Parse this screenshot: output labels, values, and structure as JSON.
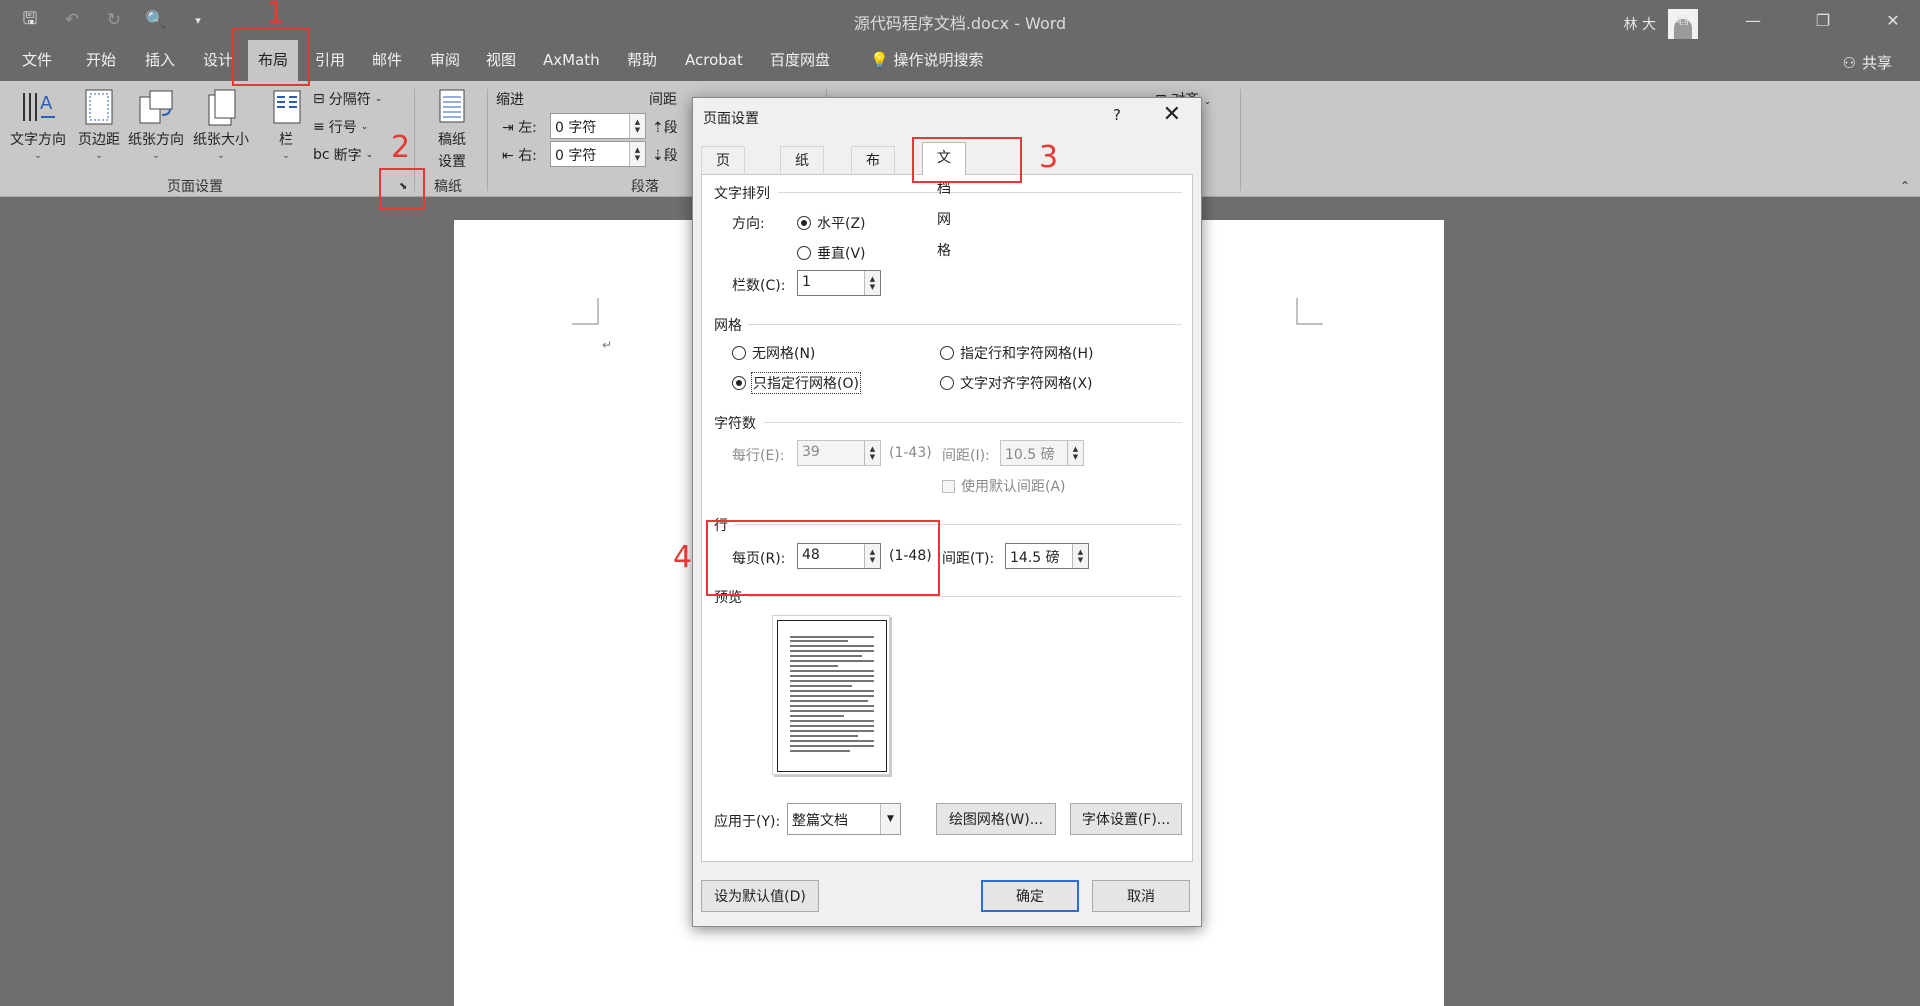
{
  "titlebar": {
    "doc_title": "源代码程序文档.docx - Word",
    "user_name": "林 大",
    "qat_icons": [
      "save-icon",
      "undo-icon",
      "redo-icon",
      "print-preview-icon",
      "customize-icon"
    ],
    "qat_glyphs": [
      "🖫",
      "↶",
      "↻",
      "🔍",
      "▾"
    ],
    "win_glyphs": [
      "⧉",
      "—",
      "❐",
      "✕"
    ]
  },
  "tabs": [
    "文件",
    "开始",
    "插入",
    "设计",
    "布局",
    "引用",
    "邮件",
    "审阅",
    "视图",
    "AxMath",
    "帮助",
    "Acrobat",
    "百度网盘",
    "操作说明搜索"
  ],
  "active_tab": "布局",
  "share_label": "共享",
  "ribbon": {
    "text_direction": "文字方向",
    "margins": "页边距",
    "orientation": "纸张方向",
    "size": "纸张大小",
    "columns": "栏",
    "breaks": "分隔符",
    "line_numbers": "行号",
    "hyphenation": "断字",
    "group_page_setup": "页面设置",
    "draft_paper_line1": "稿纸",
    "draft_paper_line2": "设置",
    "group_draft": "稿纸",
    "indent_header": "缩进",
    "indent_left_label": "左:",
    "indent_left_value": "0 字符",
    "indent_right_label": "右:",
    "indent_right_value": "0 字符",
    "spacing_header": "间距",
    "spacing_before": "段",
    "spacing_after": "段",
    "group_paragraph": "段落",
    "arrange_label": "对齐"
  },
  "annotations": {
    "n1": "1",
    "n2": "2",
    "n3": "3",
    "n4": "4",
    "color": "#e53935"
  },
  "dialog": {
    "title": "页面设置",
    "help": "?",
    "close": "✕",
    "tabs": [
      "页边距",
      "纸张",
      "布局",
      "文档网格"
    ],
    "active_tab": "文档网格",
    "text_arrangement": {
      "header": "文字排列",
      "direction_label": "方向:",
      "horizontal": "水平(Z)",
      "vertical": "垂直(V)",
      "selected": "水平(Z)",
      "columns_label": "栏数(C):",
      "columns_value": "1"
    },
    "grid": {
      "header": "网格",
      "no_grid": "无网格(N)",
      "line_and_char": "指定行和字符网格(H)",
      "lines_only": "只指定行网格(O)",
      "snap_to_chars": "文字对齐字符网格(X)",
      "selected": "只指定行网格(O)"
    },
    "chars": {
      "header": "字符数",
      "per_line_label": "每行(E):",
      "per_line_value": "39",
      "per_line_range": "(1-43)",
      "pitch_label": "间距(I):",
      "pitch_value": "10.5 磅",
      "use_default": "使用默认间距(A)"
    },
    "lines": {
      "header": "行",
      "per_page_label": "每页(R):",
      "per_page_value": "48",
      "per_page_range": "(1-48)",
      "pitch_label": "间距(T):",
      "pitch_value": "14.5 磅"
    },
    "preview_header": "预览",
    "apply_to_label": "应用于(Y):",
    "apply_to_value": "整篇文档",
    "draw_grid_button": "绘图网格(W)...",
    "font_settings_button": "字体设置(F)...",
    "set_default_button": "设为默认值(D)",
    "ok_button": "确定",
    "cancel_button": "取消"
  }
}
